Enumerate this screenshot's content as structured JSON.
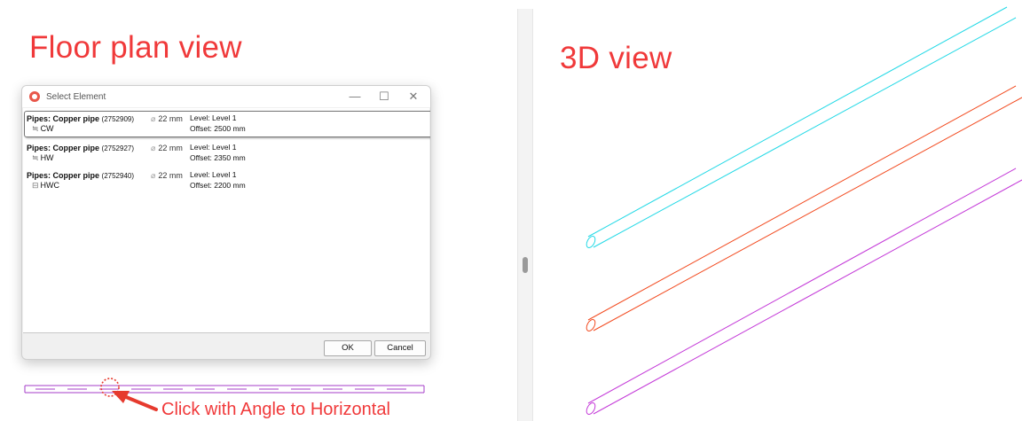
{
  "headings": {
    "left": "Floor plan view",
    "right": "3D view"
  },
  "dialog": {
    "title": "Select Element",
    "window_controls": {
      "minimize": "—",
      "maximize": "☐",
      "close": "✕"
    },
    "rows": [
      {
        "name": "Pipes: Copper pipe",
        "id": "(2752909)",
        "diameter": "22 mm",
        "level": "Level: Level 1",
        "offset": "Offset: 2500 mm",
        "system": "CW",
        "selected": true
      },
      {
        "name": "Pipes: Copper pipe",
        "id": "(2752927)",
        "diameter": "22 mm",
        "level": "Level: Level 1",
        "offset": "Offset: 2350 mm",
        "system": "HW",
        "selected": false
      },
      {
        "name": "Pipes: Copper pipe",
        "id": "(2752940)",
        "diameter": "22 mm",
        "level": "Level: Level 1",
        "offset": "Offset: 2200 mm",
        "system": "HWC",
        "selected": false
      }
    ],
    "ok_label": "OK",
    "cancel_label": "Cancel"
  },
  "callout": "Click with Angle to Horizontal",
  "colors": {
    "heading": "#f0393a",
    "pipe_cw": "#23d9e6",
    "pipe_hw": "#f24a1f",
    "pipe_hwc": "#c43ad8",
    "plan_pipe": "#a53dc9",
    "accent_red": "#e63a2e"
  },
  "icons": {
    "app": "revit-app-icon",
    "diameter": "diameter-icon",
    "system_cw": "pipe-system-icon",
    "system_hw": "pipe-system-icon",
    "system_hwc": "pipe-system-icon"
  }
}
